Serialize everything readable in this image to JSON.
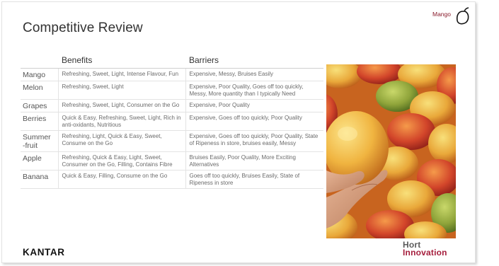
{
  "slide": {
    "title": "Competitive Review",
    "brand_tag": "Mango",
    "icons": {
      "top_right": "mango-outline-icon"
    },
    "colors": {
      "brand_tag": "#8a1c2c",
      "hort_accent": "#a51d3c"
    }
  },
  "table": {
    "headers": {
      "fruit": "",
      "benefits": "Benefits",
      "barriers": "Barriers"
    },
    "rows": [
      {
        "fruit": "Mango",
        "benefits": "Refreshing, Sweet, Light, Intense Flavour, Fun",
        "barriers": "Expensive, Messy, Bruises Easily"
      },
      {
        "fruit": "Melon",
        "benefits": "Refreshing, Sweet, Light",
        "barriers": "Expensive, Poor Quality, Goes off too quickly, Messy, More quantity than I typically Need"
      },
      {
        "fruit": "Grapes",
        "benefits": "Refreshing, Sweet, Light, Consumer on the Go",
        "barriers": "Expensive, Poor Quality"
      },
      {
        "fruit": "Berries",
        "benefits": "Quick & Easy, Refreshing, Sweet, Light, Rich in anti-oxidants, Nutritious",
        "barriers": "Expensive, Goes off too quickly, Poor Quality"
      },
      {
        "fruit": "Summer -fruit",
        "benefits": "Refreshing, Light, Quick & Easy, Sweet, Consume on the Go",
        "barriers": "Expensive, Goes off too quickly, Poor Quality, State of Ripeness in store, bruises easily, Messy"
      },
      {
        "fruit": "Apple",
        "benefits": "Refreshing, Quick & Easy, Light, Sweet, Consumer on the Go, Filling, Contains Fibre",
        "barriers": "Bruises Easily, Poor Quality, More Exciting Alternatives"
      },
      {
        "fruit": "Banana",
        "benefits": "Quick & Easy, Filling, Consume on the Go",
        "barriers": "Goes off too quickly, Bruises Easily, State of Ripeness in store"
      }
    ]
  },
  "footer": {
    "kantar_logo": "KANTAR",
    "hort_logo_line1": "Hort",
    "hort_logo_line2": "Innovation"
  }
}
